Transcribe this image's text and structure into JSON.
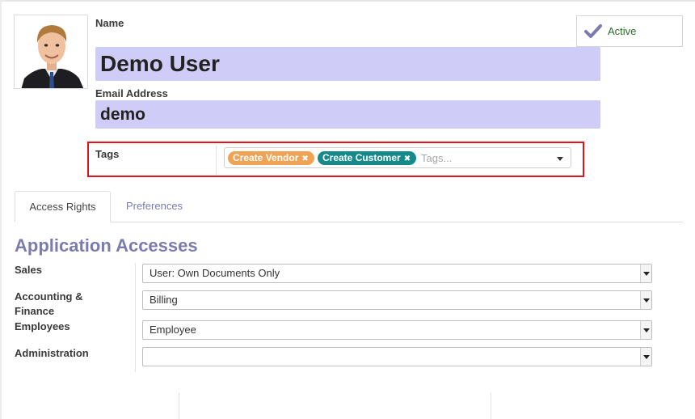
{
  "user": {
    "name_label": "Name",
    "name_value": "Demo User",
    "email_label": "Email Address",
    "email_value": "demo",
    "active_label": "Active"
  },
  "tags": {
    "label": "Tags",
    "items": [
      {
        "label": "Create Vendor",
        "color": "#f0a354"
      },
      {
        "label": "Create Customer",
        "color": "#168a8a"
      }
    ],
    "remove_glyph": "✖",
    "placeholder": "Tags..."
  },
  "tabs": [
    {
      "label": "Access Rights",
      "active": true
    },
    {
      "label": "Preferences",
      "active": false
    }
  ],
  "access": {
    "title": "Application Accesses",
    "rows": [
      {
        "label": "Sales",
        "value": "User: Own Documents Only"
      },
      {
        "label": "Accounting & Finance",
        "value": "Billing"
      },
      {
        "label": "Employees",
        "value": "Employee"
      },
      {
        "label": "Administration",
        "value": ""
      }
    ]
  },
  "colors": {
    "accent": "#7c7bad",
    "required_field": "#cfcdf7",
    "highlight_border": "#e0151b",
    "active_text": "#2a6b2a"
  }
}
